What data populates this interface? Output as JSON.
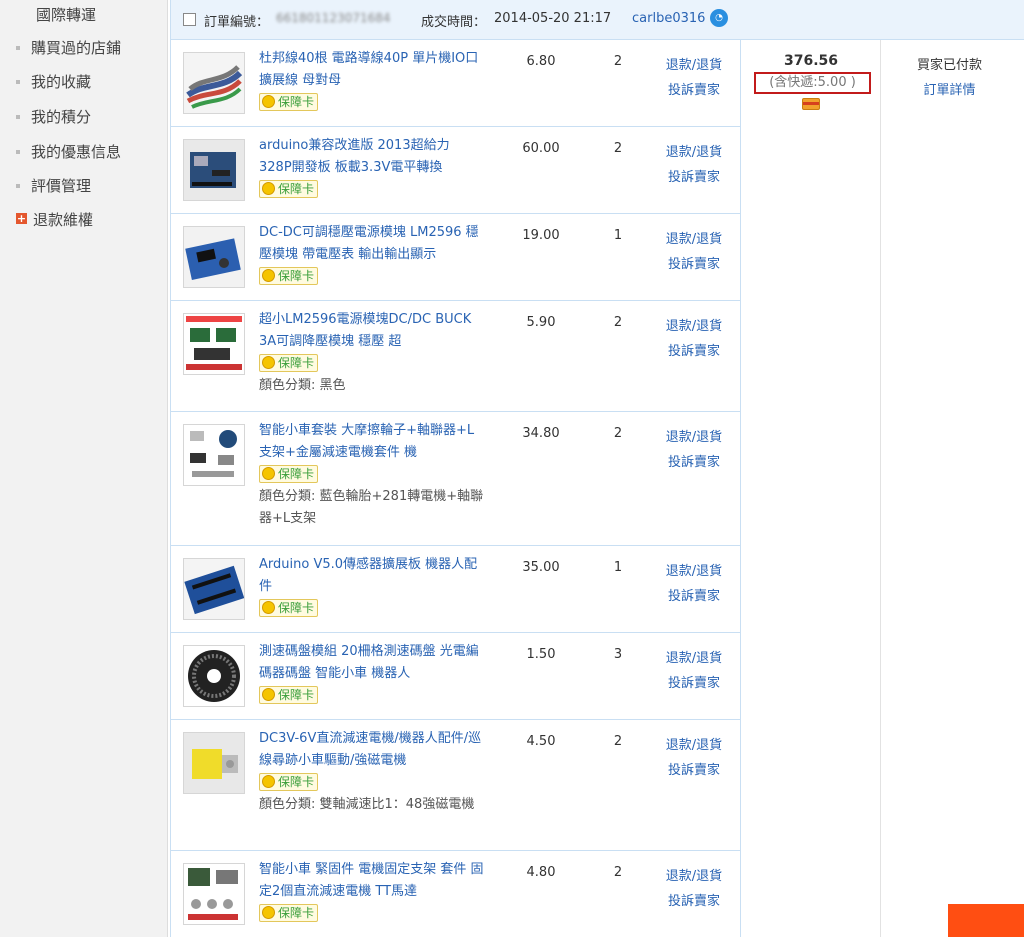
{
  "sidebar": {
    "items": [
      {
        "label": "國際轉運"
      },
      {
        "label": "購買過的店鋪"
      },
      {
        "label": "我的收藏"
      },
      {
        "label": "我的積分"
      },
      {
        "label": "我的優惠信息"
      },
      {
        "label": "評價管理"
      },
      {
        "label": "退款維權"
      }
    ]
  },
  "order": {
    "order_no_label": "訂單編號：",
    "order_no": "661801123071684",
    "time_label": "成交時間：",
    "time": "2014-05-20 21:17",
    "seller": "carlbe0316"
  },
  "badge_label": "保障卡",
  "actions": {
    "refund": "退款/退貨",
    "complain": "投訴賣家"
  },
  "items": [
    {
      "title": "杜邦線40根 電路導線40P 單片機IO口擴展線 母對母",
      "price": "6.80",
      "qty": "2",
      "color": ""
    },
    {
      "title": "arduino兼容改進版 2013超給力 328P開發板 板載3.3V電平轉換",
      "price": "60.00",
      "qty": "2",
      "color": ""
    },
    {
      "title": "DC-DC可調穩壓電源模塊 LM2596 穩壓模塊 帶電壓表 輸出輸出顯示",
      "price": "19.00",
      "qty": "1",
      "color": ""
    },
    {
      "title": "超小LM2596電源模塊DC/DC BUCK 3A可調降壓模塊 穩壓 超",
      "price": "5.90",
      "qty": "2",
      "color": "顏色分類: 黑色"
    },
    {
      "title": "智能小車套裝 大摩擦輪子+軸聯器+L支架+金屬減速電機套件 機",
      "price": "34.80",
      "qty": "2",
      "color": "顏色分類: 藍色輪胎+281轉電機+軸聯器+L支架"
    },
    {
      "title": "Arduino V5.0傳感器擴展板 機器人配件",
      "price": "35.00",
      "qty": "1",
      "color": ""
    },
    {
      "title": "測速碼盤模組 20柵格測速碼盤 光電編碼器碼盤 智能小車 機器人",
      "price": "1.50",
      "qty": "3",
      "color": ""
    },
    {
      "title": "DC3V-6V直流減速電機/機器人配件/巡線尋跡小車驅動/強磁電機",
      "price": "4.50",
      "qty": "2",
      "color": "顏色分類: 雙軸減速比1：48強磁電機"
    },
    {
      "title": "智能小車 緊固件 電機固定支架 套件 固定2個直流減速電機 TT馬達",
      "price": "4.80",
      "qty": "2",
      "color": ""
    }
  ],
  "summary": {
    "total": "376.56",
    "shipping": "(含快遞:5.00 )",
    "status": "買家已付款",
    "detail_link": "訂單詳情"
  }
}
